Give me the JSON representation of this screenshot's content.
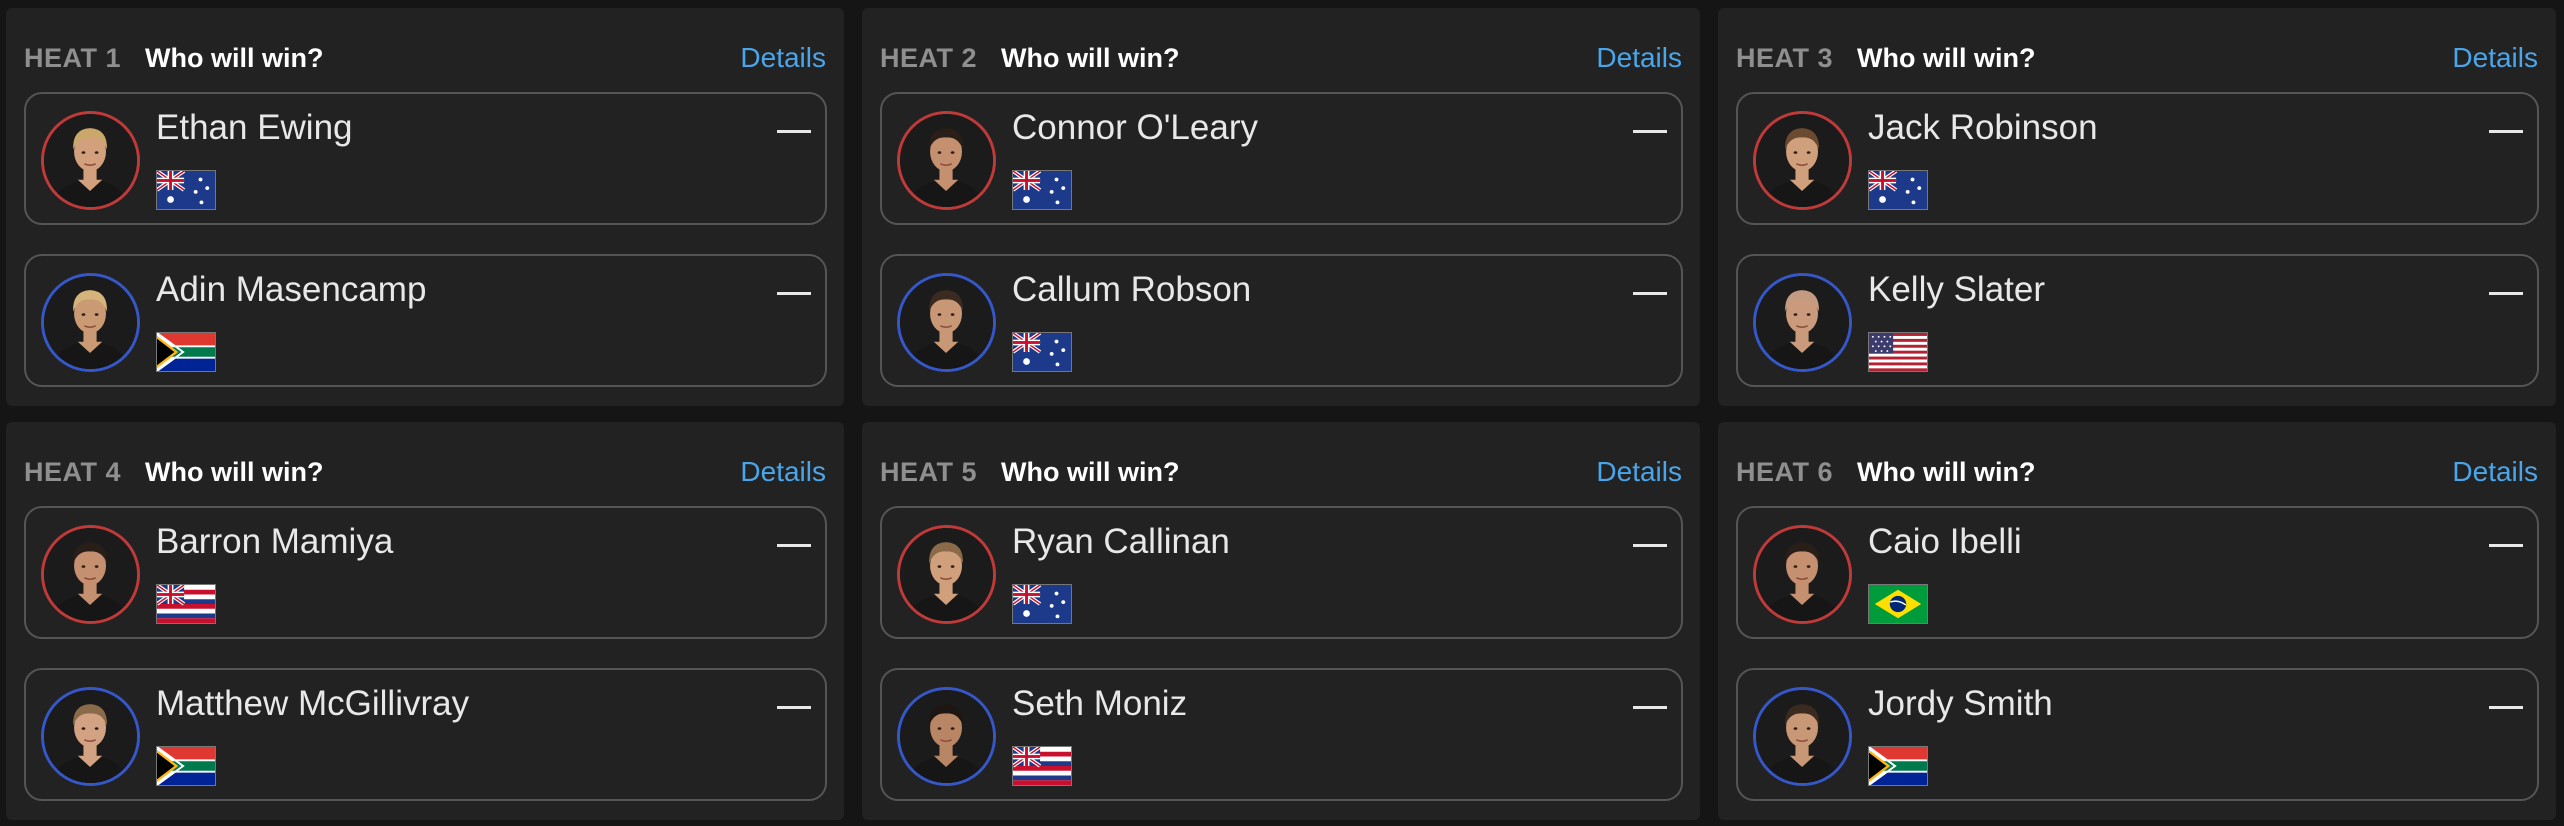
{
  "heats": [
    {
      "num": "HEAT 1",
      "question": "Who will win?",
      "details": "Details",
      "surfers": [
        {
          "name": "Ethan Ewing",
          "flag": "flag-australia",
          "color": "red",
          "hair": "#c9a86a",
          "skin": "#d2a07c"
        },
        {
          "name": "Adin Masencamp",
          "flag": "flag-south-africa",
          "color": "blue",
          "hair": "#d4b47a",
          "skin": "#c99a74"
        }
      ]
    },
    {
      "num": "HEAT 2",
      "question": "Who will win?",
      "details": "Details",
      "surfers": [
        {
          "name": "Connor O'Leary",
          "flag": "flag-australia",
          "color": "red",
          "hair": "#2a1e18",
          "skin": "#c49070"
        },
        {
          "name": "Callum Robson",
          "flag": "flag-australia",
          "color": "blue",
          "hair": "#3a2a20",
          "skin": "#c89876"
        }
      ]
    },
    {
      "num": "HEAT 3",
      "question": "Who will win?",
      "details": "Details",
      "surfers": [
        {
          "name": "Jack Robinson",
          "flag": "flag-australia",
          "color": "red",
          "hair": "#6b4a30",
          "skin": "#d0a07c"
        },
        {
          "name": "Kelly Slater",
          "flag": "flag-usa",
          "color": "blue",
          "hair": "#c49a80",
          "skin": "#c99a7c"
        }
      ]
    },
    {
      "num": "HEAT 4",
      "question": "Who will win?",
      "details": "Details",
      "surfers": [
        {
          "name": "Barron Mamiya",
          "flag": "flag-hawaii",
          "color": "red",
          "hair": "#2a1e18",
          "skin": "#c49070"
        },
        {
          "name": "Matthew McGillivray",
          "flag": "flag-south-africa",
          "color": "blue",
          "hair": "#8a6a48",
          "skin": "#d2a282"
        }
      ]
    },
    {
      "num": "HEAT 5",
      "question": "Who will win?",
      "details": "Details",
      "surfers": [
        {
          "name": "Ryan Callinan",
          "flag": "flag-australia",
          "color": "red",
          "hair": "#8a6a48",
          "skin": "#d0a07c"
        },
        {
          "name": "Seth Moniz",
          "flag": "flag-hawaii",
          "color": "blue",
          "hair": "#1e1612",
          "skin": "#b88664"
        }
      ]
    },
    {
      "num": "HEAT 6",
      "question": "Who will win?",
      "details": "Details",
      "surfers": [
        {
          "name": "Caio Ibelli",
          "flag": "flag-brazil",
          "color": "red",
          "hair": "#2a1e18",
          "skin": "#c49070"
        },
        {
          "name": "Jordy Smith",
          "flag": "flag-south-africa",
          "color": "blue",
          "hair": "#3a2a20",
          "skin": "#c89876"
        }
      ]
    }
  ],
  "score_placeholder": "—",
  "colors": {
    "accent": "#4aa6ea",
    "red_ring": "#c03a3a",
    "blue_ring": "#3557c8",
    "panel": "#222222",
    "background": "#151515"
  }
}
